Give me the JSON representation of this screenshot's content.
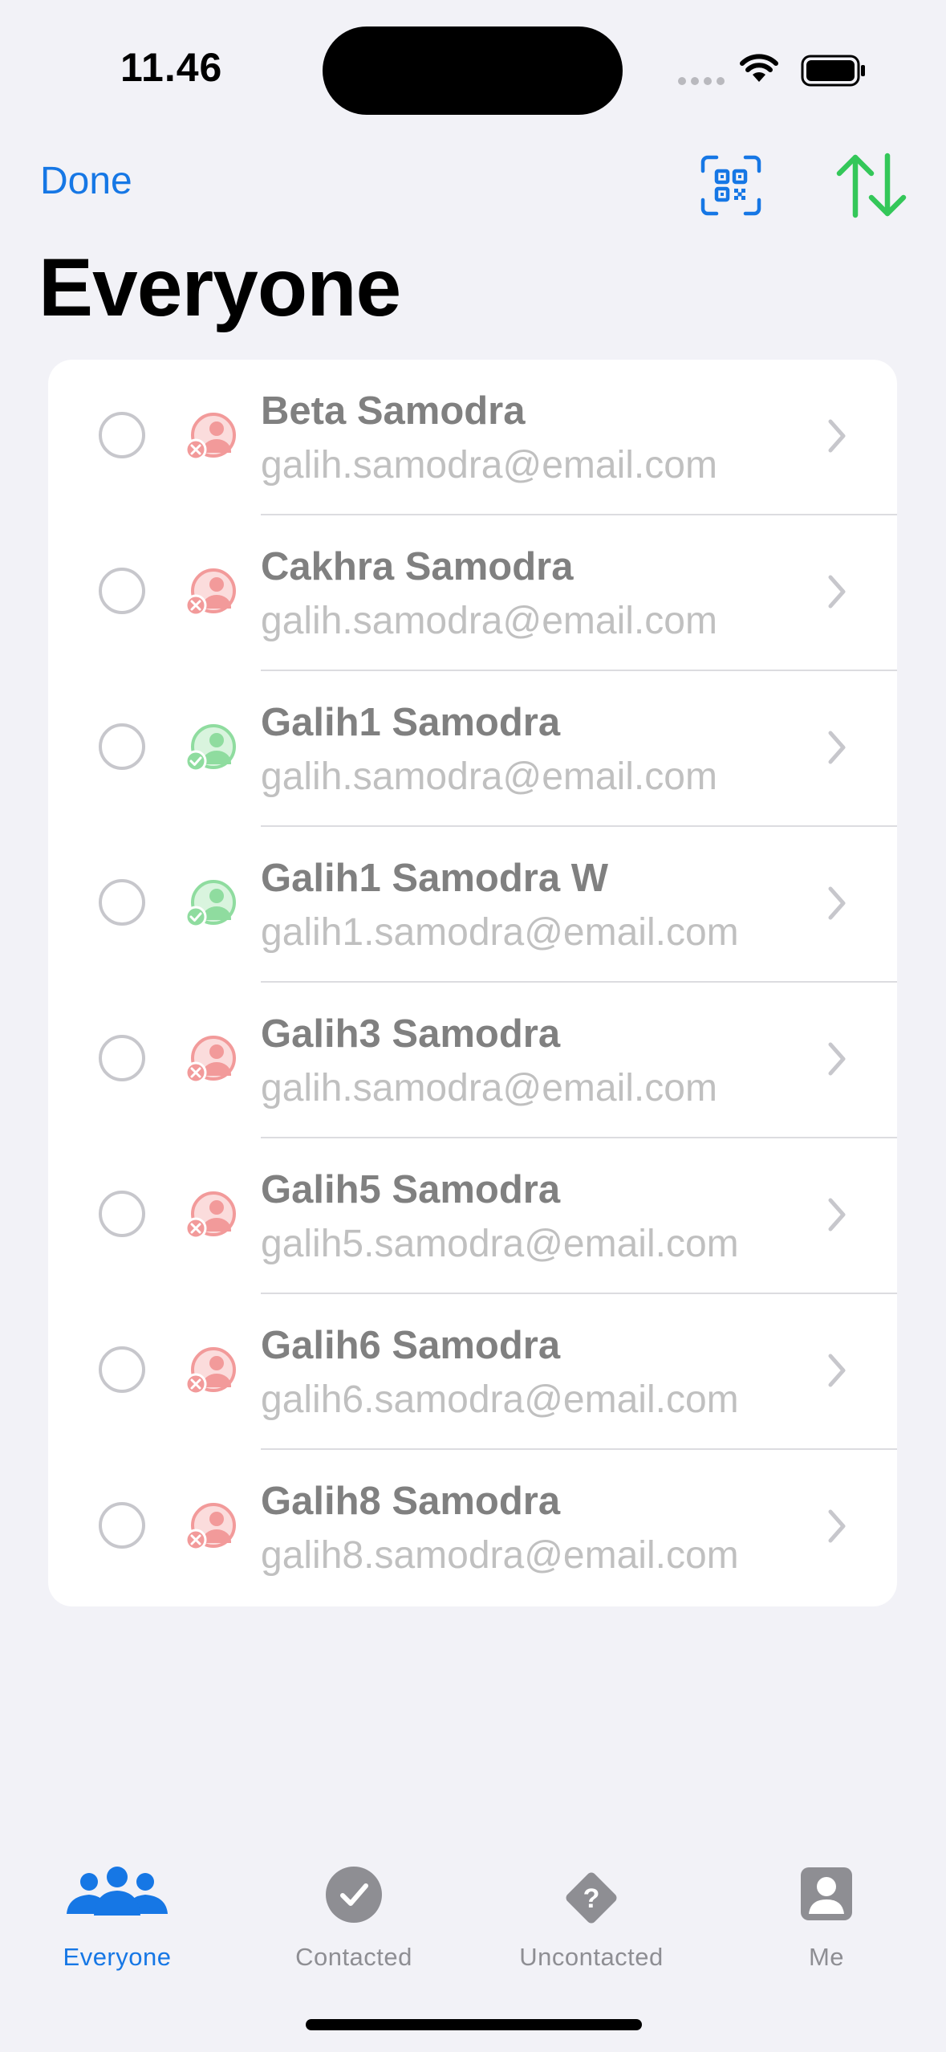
{
  "status_bar": {
    "time": "11.46"
  },
  "nav": {
    "done_label": "Done"
  },
  "page": {
    "title": "Everyone"
  },
  "colors": {
    "accent": "#1677e5",
    "sort_green": "#34c759",
    "uncontacted_red": "#f29a9a",
    "contacted_green": "#8fdc9f"
  },
  "people": [
    {
      "name": "Beta Samodra",
      "email": "galih.samodra@email.com",
      "status": "uncontacted"
    },
    {
      "name": "Cakhra Samodra",
      "email": "galih.samodra@email.com",
      "status": "uncontacted"
    },
    {
      "name": "Galih1 Samodra",
      "email": "galih.samodra@email.com",
      "status": "contacted"
    },
    {
      "name": "Galih1 Samodra W",
      "email": "galih1.samodra@email.com",
      "status": "contacted"
    },
    {
      "name": "Galih3 Samodra",
      "email": "galih.samodra@email.com",
      "status": "uncontacted"
    },
    {
      "name": "Galih5 Samodra",
      "email": "galih5.samodra@email.com",
      "status": "uncontacted"
    },
    {
      "name": "Galih6 Samodra",
      "email": "galih6.samodra@email.com",
      "status": "uncontacted"
    },
    {
      "name": "Galih8 Samodra",
      "email": "galih8.samodra@email.com",
      "status": "uncontacted"
    }
  ],
  "tabs": [
    {
      "label": "Everyone",
      "icon": "people-icon",
      "active": true
    },
    {
      "label": "Contacted",
      "icon": "checkmark-circle-icon",
      "active": false
    },
    {
      "label": "Uncontacted",
      "icon": "question-diamond-icon",
      "active": false
    },
    {
      "label": "Me",
      "icon": "person-square-icon",
      "active": false
    }
  ]
}
